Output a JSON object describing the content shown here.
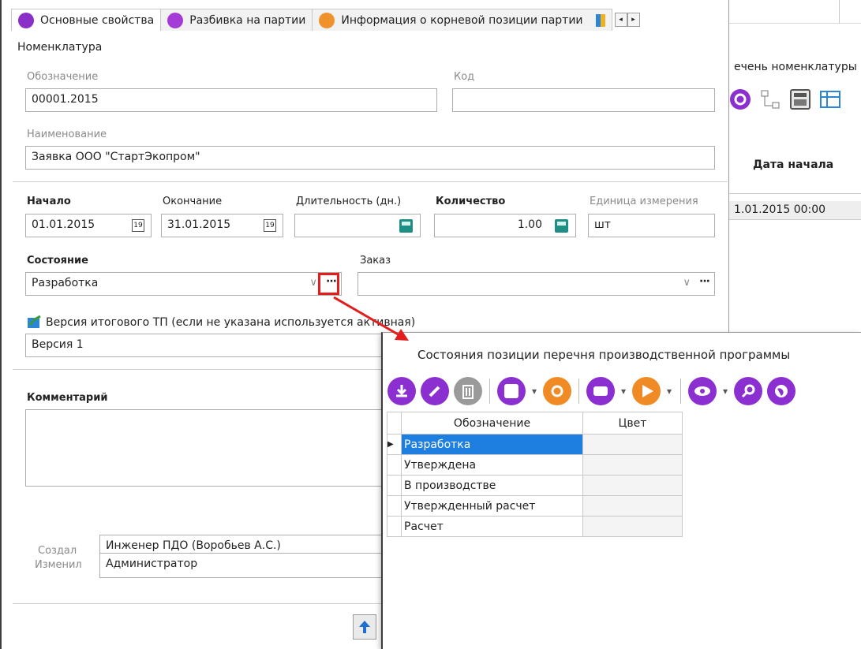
{
  "background_window": {
    "caption": "ечень номенклатуры",
    "column_header": "Дата начала",
    "row_value": "1.01.2015 00:00"
  },
  "tabs": [
    {
      "label": "Основные свойства",
      "icon": "properties-icon",
      "color": "#8a2fc8"
    },
    {
      "label": "Разбивка на партии",
      "icon": "batch-split-icon",
      "color": "#a43bd6"
    },
    {
      "label": "Информация о корневой позиции партии",
      "icon": "root-info-icon",
      "color": "#f0922b"
    }
  ],
  "tab_nav": {
    "prev": "◂",
    "next": "▸"
  },
  "form": {
    "section_title": "Номенклатура",
    "designation": {
      "label": "Обозначение",
      "value": "00001.2015"
    },
    "code": {
      "label": "Код",
      "value": ""
    },
    "name": {
      "label": "Наименование",
      "value": "Заявка ООО \"СтартЭкопром\""
    },
    "start": {
      "label": "Начало",
      "value": "01.01.2015"
    },
    "end": {
      "label": "Окончание",
      "value": "31.01.2015"
    },
    "duration": {
      "label": "Длительность (дн.)",
      "value": ""
    },
    "quantity": {
      "label": "Количество",
      "value": "1.00"
    },
    "unit": {
      "label": "Единица измерения",
      "value": "шт"
    },
    "state": {
      "label": "Состояние",
      "value": "Разработка"
    },
    "order": {
      "label": "Заказ",
      "value": ""
    },
    "version": {
      "label": "Версия итогового ТП (если не указана используется активная)",
      "value": "Версия 1"
    },
    "comment": {
      "label": "Комментарий",
      "value": ""
    },
    "created_by": {
      "label": "Создал",
      "value": "Инженер ПДО (Воробьев А.С.)"
    },
    "modified_by": {
      "label": "Изменил",
      "value": "Администратор"
    },
    "calendar_glyph": "19",
    "dots": "···",
    "combo_arrow": "∨"
  },
  "popup": {
    "title": "Состояния позиции перечня производственной программы",
    "columns": [
      "Обозначение",
      "Цвет"
    ],
    "rows": [
      {
        "name": "Разработка",
        "selected": true
      },
      {
        "name": "Утверждена",
        "selected": false
      },
      {
        "name": "В производстве",
        "selected": false
      },
      {
        "name": "Утвержденный расчет",
        "selected": false
      },
      {
        "name": "Расчет",
        "selected": false
      }
    ],
    "row_indicator": "▶",
    "caret": "▾",
    "toolbar_colors": {
      "purple": "#8b2fd0",
      "gray": "#9a9a9a",
      "orange": "#f08a24",
      "blue": "#2c86d8"
    }
  },
  "colors": {
    "highlight": "#e41c1c",
    "selection": "#1e7fe0",
    "accent_purple": "#8b2fd0"
  }
}
